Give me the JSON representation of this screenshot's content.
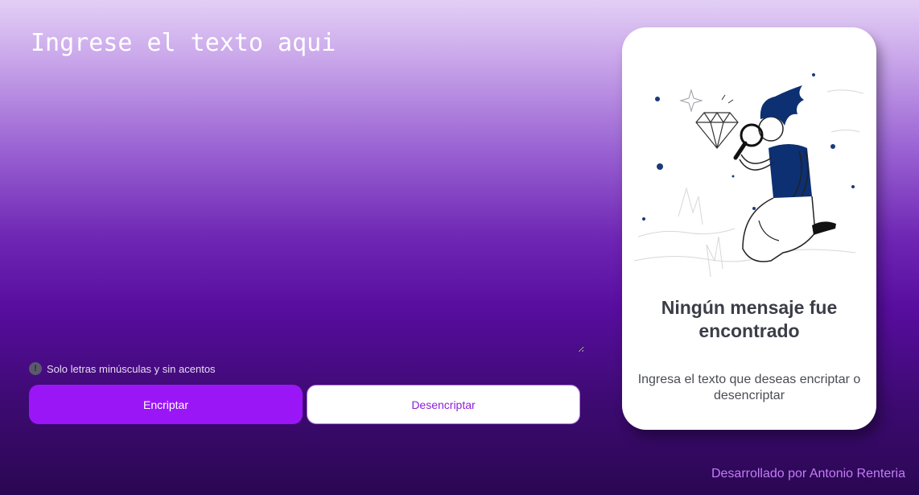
{
  "input": {
    "placeholder": "Ingrese el texto aqui"
  },
  "hint": {
    "icon": "info-icon",
    "text": "Solo letras minúsculas y sin acentos"
  },
  "buttons": {
    "encrypt": "Encriptar",
    "decrypt": "Desencriptar"
  },
  "output": {
    "illustration": "search-person-illustration",
    "title": "Ningún mensaje fue encontrado",
    "subtitle": "Ingresa el texto que deseas encriptar o desencriptar"
  },
  "footer": {
    "credit": "Desarrollado por Antonio Renteria"
  },
  "colors": {
    "accent": "#9a16f7",
    "decrypt_text": "#8a1fd6",
    "credit": "#c47cf5",
    "figure": "#0d3072"
  }
}
